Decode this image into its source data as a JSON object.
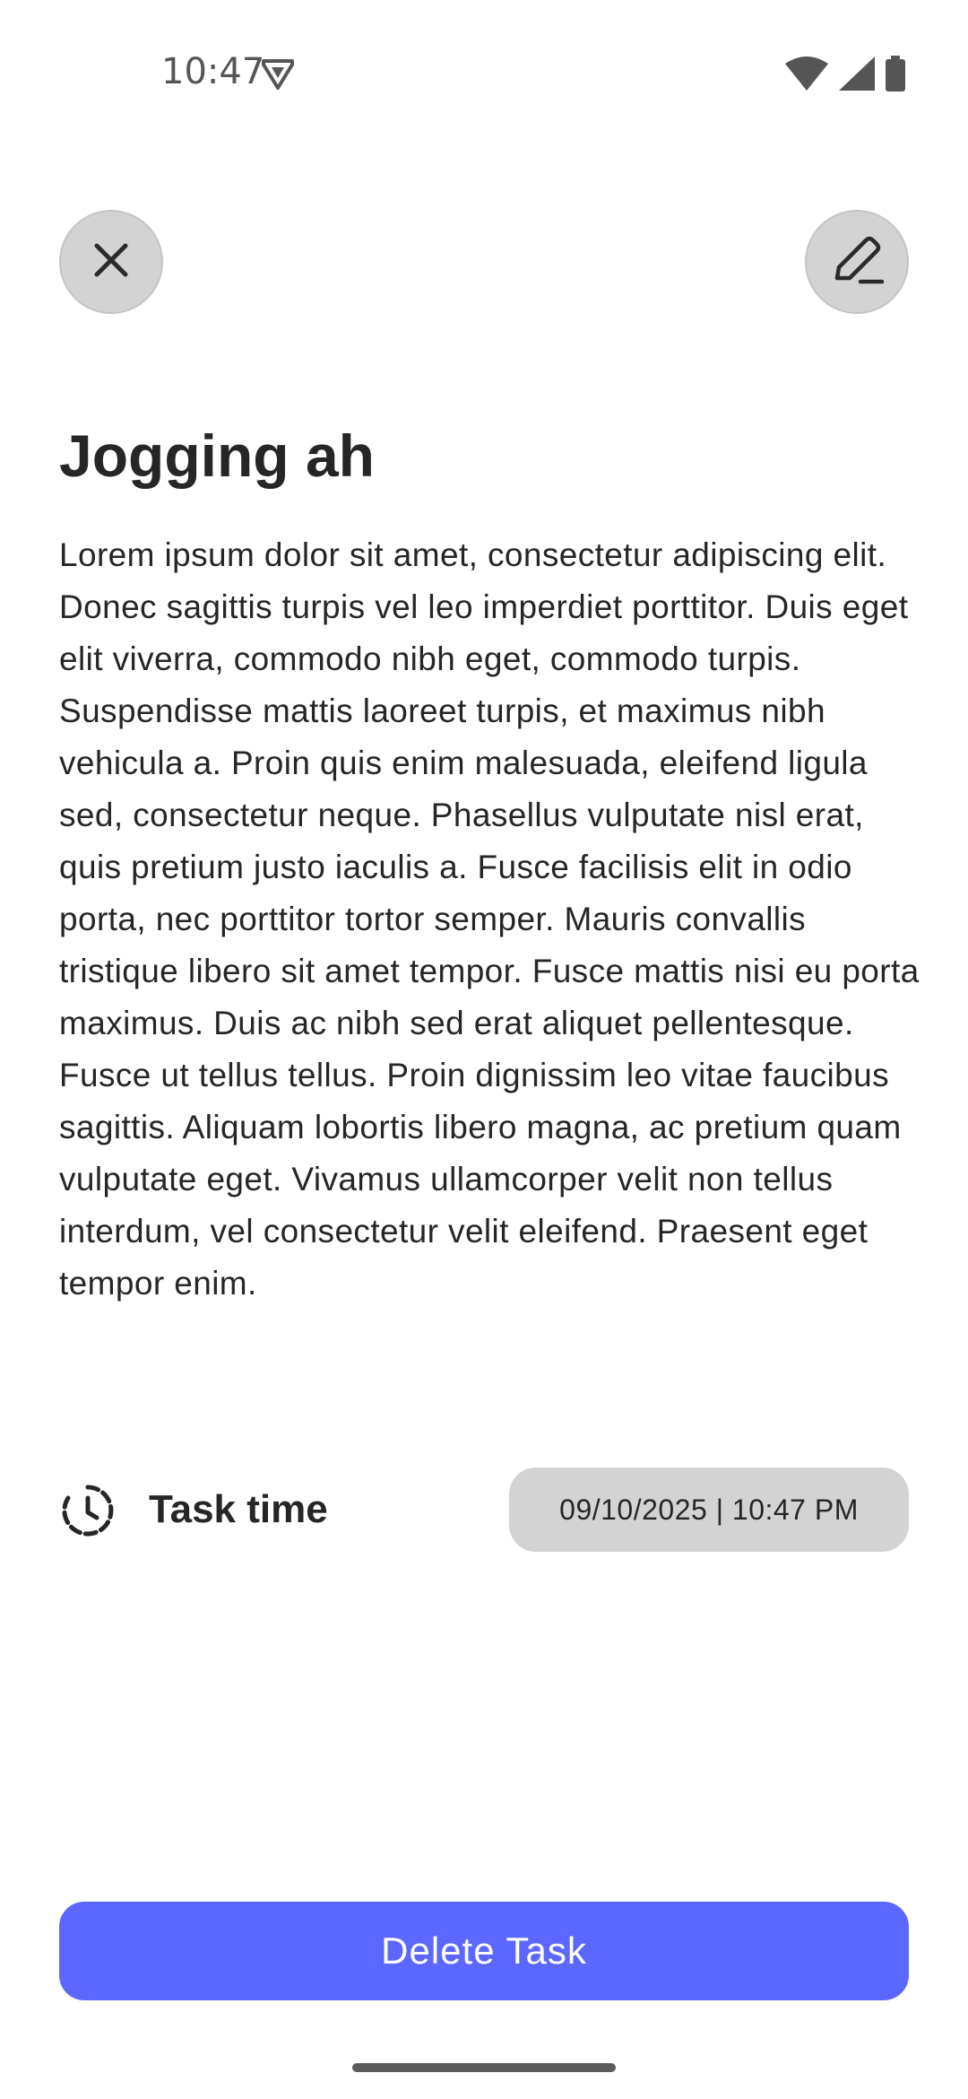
{
  "status_bar": {
    "time": "10:47",
    "left_icon": "shield-icon",
    "right_icons": [
      "wifi-icon",
      "signal-icon",
      "battery-icon"
    ]
  },
  "toolbar": {
    "close_icon": "close-icon",
    "edit_icon": "pencil-icon"
  },
  "task": {
    "title": "Jogging ah",
    "description": "Lorem ipsum dolor sit amet, consectetur adipiscing elit. Donec sagittis turpis vel leo imperdiet porttitor. Duis eget elit viverra, commodo nibh eget, commodo turpis. Suspendisse mattis laoreet turpis, et maximus nibh vehicula a. Proin quis enim malesuada, eleifend ligula sed, consectetur neque. Phasellus vulputate nisl erat, quis pretium justo iaculis a. Fusce facilisis elit in odio porta, nec porttitor tortor semper. Mauris convallis tristique libero sit amet tempor. Fusce mattis nisi eu porta maximus. Duis ac nibh sed erat aliquet pellentesque. Fusce ut tellus tellus. Proin dignissim leo vitae faucibus sagittis. Aliquam lobortis libero magna, ac pretium quam vulputate eget. Vivamus ullamcorper velit non tellus interdum, vel consectetur velit eleifend. Praesent eget tempor enim.",
    "time_label": "Task time",
    "time_icon": "clock-icon",
    "time_value": "09/10/2025 | 10:47 PM"
  },
  "actions": {
    "delete_label": "Delete Task"
  },
  "colors": {
    "accent": "#5b67ff",
    "chip_background": "#d3d3d3",
    "text": "#262626"
  }
}
